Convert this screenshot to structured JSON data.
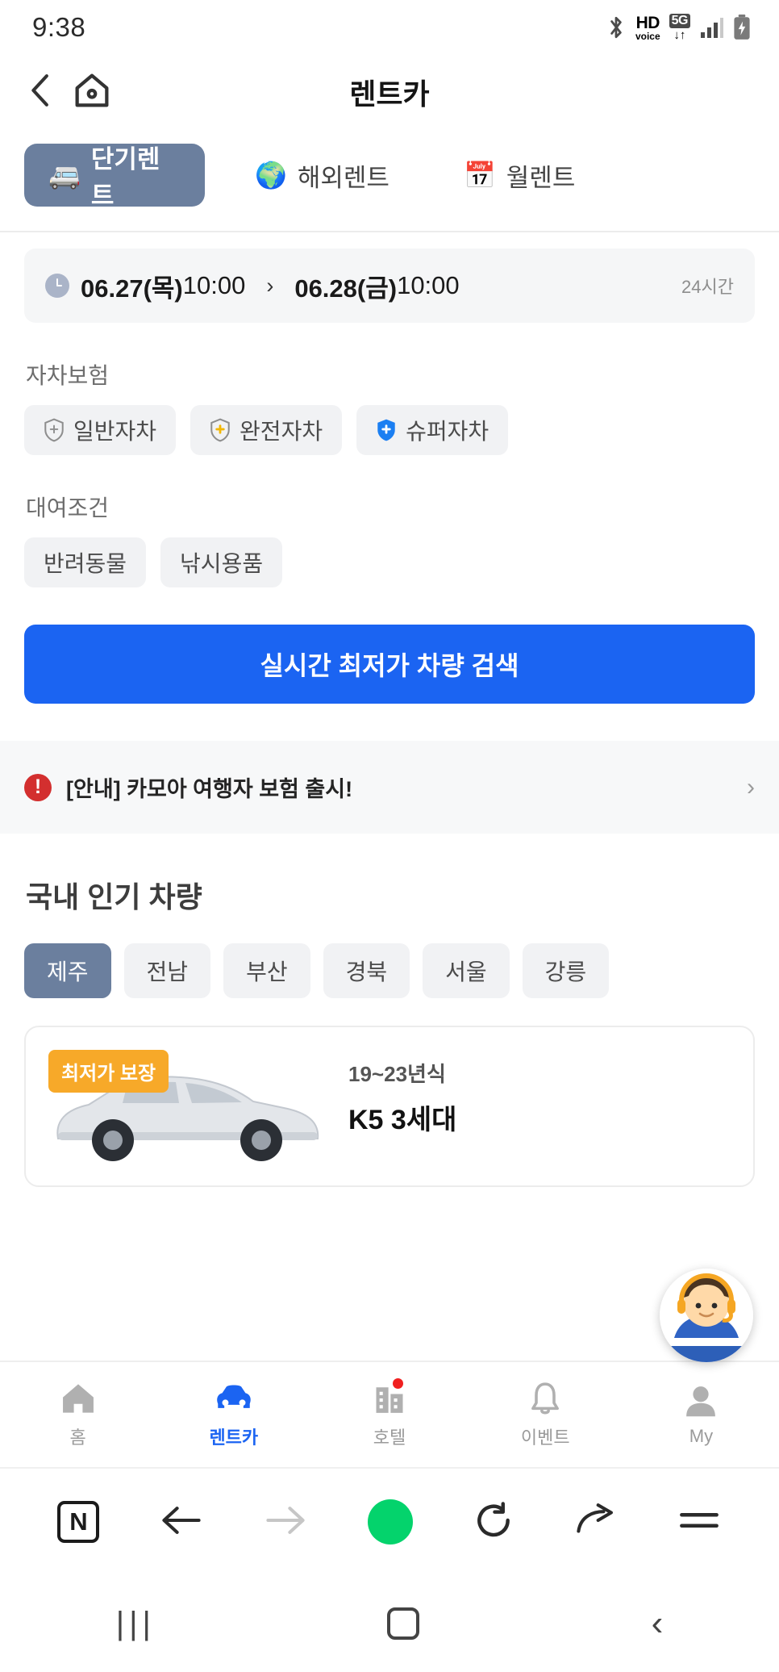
{
  "statusbar": {
    "time": "9:38",
    "icons": [
      "bluetooth-icon",
      "hd-voice-icon",
      "5g-data-icon",
      "signal-bars-icon",
      "battery-charging-icon"
    ],
    "hd_label": "HD",
    "voice_label": "voice",
    "fiveg_label": "5G",
    "fiveg_arrows": "↓↑"
  },
  "header": {
    "back_icon": "chevron-left-icon",
    "home_icon": "home-icon",
    "title": "렌트카"
  },
  "tabs": [
    {
      "label": "단기렌트",
      "emoji": "🚐",
      "active": true
    },
    {
      "label": "해외렌트",
      "emoji": "🌍",
      "active": false
    },
    {
      "label": "월렌트",
      "emoji": "📅",
      "active": false
    }
  ],
  "date_bar": {
    "start_date": "06.27(목)",
    "start_time": "10:00",
    "arrow": "›",
    "end_date": "06.28(금)",
    "end_time": "10:00",
    "duration": "24시간",
    "clock_icon": "clock-icon"
  },
  "insurance": {
    "label": "자차보험",
    "options": [
      {
        "label": "일반자차",
        "icon": "shield-plus-gray-icon",
        "color": "#8e8e8e"
      },
      {
        "label": "완전자차",
        "icon": "shield-plus-yellow-icon",
        "color": "#f2b705"
      },
      {
        "label": "슈퍼자차",
        "icon": "shield-plus-blue-icon",
        "color": "#1b7ff2"
      }
    ]
  },
  "conditions": {
    "label": "대여조건",
    "options": [
      {
        "label": "반려동물"
      },
      {
        "label": "낚시용품"
      }
    ]
  },
  "cta": {
    "label": "실시간 최저가 차량 검색",
    "color": "#1b64f2"
  },
  "notice": {
    "icon": "alert-circle-icon",
    "text": "[안내] 카모아 여행자 보험 출시!",
    "chevron": "›",
    "icon_color": "#d32f2f"
  },
  "popular": {
    "title": "국내 인기 차량",
    "regions": [
      {
        "label": "제주",
        "active": true
      },
      {
        "label": "전남",
        "active": false
      },
      {
        "label": "부산",
        "active": false
      },
      {
        "label": "경북",
        "active": false
      },
      {
        "label": "서울",
        "active": false
      },
      {
        "label": "강릉",
        "active": false
      }
    ],
    "car": {
      "badge": "최저가 보장",
      "badge_color": "#f7a929",
      "year": "19~23년식",
      "name": "K5 3세대",
      "image": "sedan-car-image"
    }
  },
  "consultant": {
    "icon": "headset-agent-avatar"
  },
  "bottom_nav": [
    {
      "label": "홈",
      "icon": "home-icon",
      "active": false,
      "badge": false
    },
    {
      "label": "렌트카",
      "icon": "car-icon",
      "active": true,
      "badge": false
    },
    {
      "label": "호텔",
      "icon": "building-icon",
      "active": false,
      "badge": true
    },
    {
      "label": "이벤트",
      "icon": "bell-icon",
      "active": false,
      "badge": false
    },
    {
      "label": "My",
      "icon": "person-icon",
      "active": false,
      "badge": false
    }
  ],
  "browser_bar": {
    "logo": "N",
    "items": [
      "naver-logo-icon",
      "back-arrow-icon",
      "forward-arrow-icon",
      "record-circle-icon",
      "refresh-icon",
      "share-icon",
      "menu-icon"
    ]
  },
  "android_nav": {
    "recent_icon": "recents-icon",
    "recent_glyph": "|||",
    "home_icon": "home-square-icon",
    "back_icon": "back-chevron-icon",
    "back_glyph": "‹"
  }
}
